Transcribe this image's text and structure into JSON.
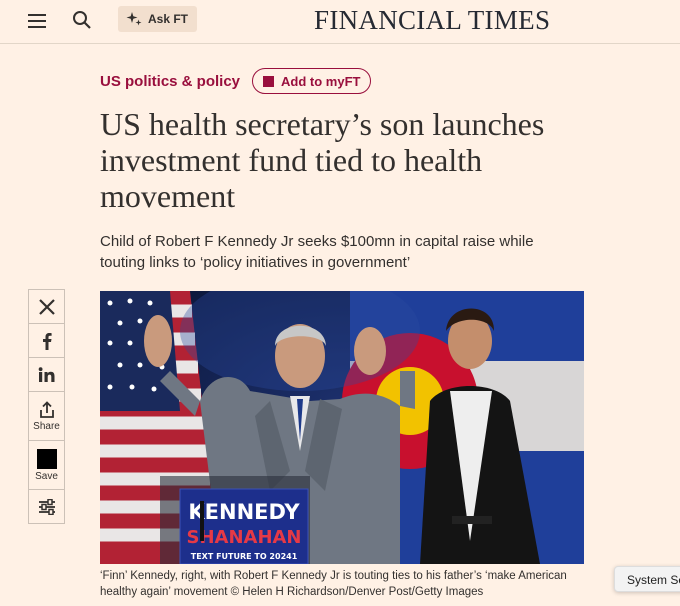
{
  "header": {
    "logo": "FINANCIAL TIMES",
    "askft_label": "Ask FT"
  },
  "article": {
    "topic": "US politics & policy",
    "myft_label": "Add to myFT",
    "headline": "US health secretary’s son launches investment fund tied to health movement",
    "standfirst": "Child of Robert F Kennedy Jr seeks $100mn in capital raise while touting links to ‘policy initiatives in government’",
    "caption": "‘Finn’ Kennedy, right, with Robert F Kennedy Jr is touting ties to his father’s ‘make American healthy again’ movement © Helen H Richardson/Denver Post/Getty Images"
  },
  "share": {
    "share_label": "Share",
    "save_label": "Save"
  },
  "photo": {
    "sign_line1": "KENNEDY",
    "sign_line2": "SHANAHAN",
    "sign_line3": "TEXT FUTURE TO 20241"
  },
  "system_button": "System Settings",
  "colors": {
    "background": "#fff1e5",
    "claret": "#990f3d",
    "text": "#33302e"
  }
}
